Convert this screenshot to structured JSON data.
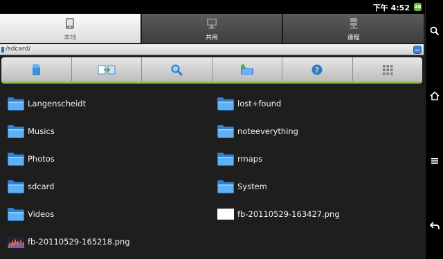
{
  "status": {
    "time": "下午 4:52",
    "battery": "46"
  },
  "tabs": [
    {
      "label": "本地",
      "icon": "device-icon",
      "active": true
    },
    {
      "label": "共用",
      "icon": "computer-icon",
      "active": false
    },
    {
      "label": "遠程",
      "icon": "network-icon",
      "active": false
    }
  ],
  "path": {
    "text": "/sdcard/"
  },
  "toolbar": {
    "items": [
      "sdcard-icon",
      "transfer-icon",
      "search-icon",
      "new-folder-icon",
      "help-icon",
      "grid-view-icon"
    ]
  },
  "files": [
    {
      "name": "Langenscheidt",
      "type": "folder"
    },
    {
      "name": "lost+found",
      "type": "folder"
    },
    {
      "name": "Musics",
      "type": "folder"
    },
    {
      "name": "noteeverything",
      "type": "folder"
    },
    {
      "name": "Photos",
      "type": "folder"
    },
    {
      "name": "rmaps",
      "type": "folder"
    },
    {
      "name": "sdcard",
      "type": "folder"
    },
    {
      "name": "System",
      "type": "folder"
    },
    {
      "name": "Videos",
      "type": "folder"
    },
    {
      "name": "fb-20110529-163427.png",
      "type": "image-blank"
    },
    {
      "name": "fb-20110529-165218.png",
      "type": "image-thumb"
    }
  ],
  "nav": [
    "search-icon",
    "home-icon",
    "menu-icon",
    "back-icon"
  ],
  "colors": {
    "accent_green": "#8bc34a",
    "folder_blue": "#3d8fe0",
    "background": "#1e1e1e"
  }
}
